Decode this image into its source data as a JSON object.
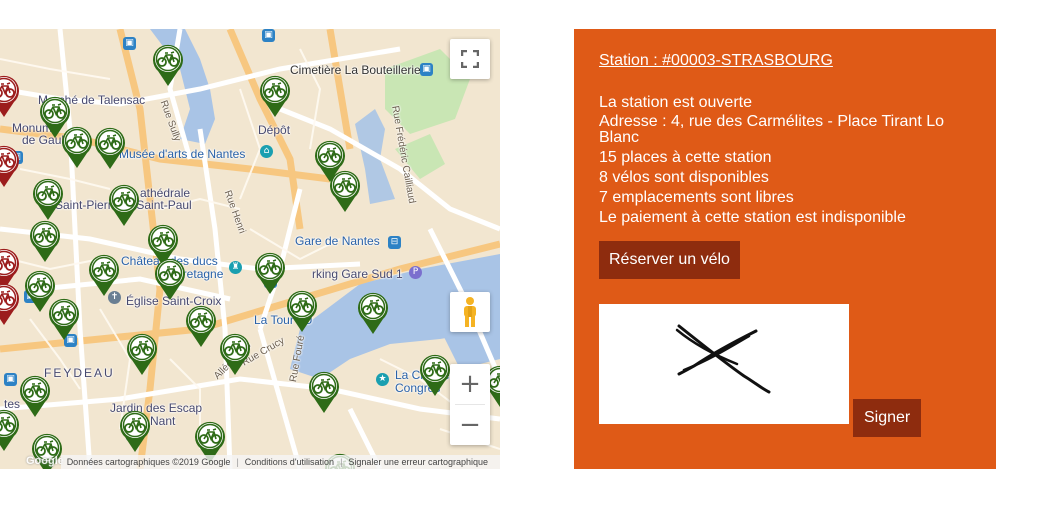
{
  "map": {
    "labels": {
      "cimetiere": "Cimetière La Bouteillerie",
      "talensac": "Marché de Talensac",
      "monument": "Monume",
      "degaulle": "de Gaulle",
      "depot": "Dépôt",
      "musee": "Musée d'arts de Nantes",
      "cathedrale": "athédrale",
      "saintpierre": "Saint-Pierre-et-Saint-Paul",
      "chateau1": "Château des ducs",
      "chateau2": "de Bretagne",
      "gare": "Gare de Nantes",
      "parking": "rking Gare Sud 1",
      "eglise": "Église Saint-Croix",
      "tourlu": "La Tour LU",
      "feydeau": "FEYDEAU",
      "citecongres1": "La Cité des",
      "citecongres2": "Congrès",
      "jardin1": "Jardin des Escap",
      "jardin2": "e Nant",
      "rue_sully": "Rue Sully",
      "rue_henri": "Rue Henri",
      "rue_cailliaud": "Rue Frédéric Cailliaud",
      "allee_baco": "Allée Baco",
      "rue_crucy": "Rue Crucy",
      "rue_fouré": "Rue Fouré",
      "ts": "tes",
      "as": "as"
    },
    "attribution": {
      "data": "Données cartographiques ©2019 Google",
      "terms": "Conditions d'utilisation",
      "report": "Signaler une erreur cartographique"
    },
    "google_logo": "Google",
    "zoom_in": "+",
    "zoom_out": "−",
    "marker_icon": "bicycle-icon",
    "marker_colors": {
      "available": "#2e6b17",
      "empty": "#9c1d1d"
    }
  },
  "station": {
    "title": "Station : #00003-STRASBOURG",
    "status": "La station est ouverte",
    "address": "Adresse : 4, rue des Carmélites - Place Tirant Lo Blanc",
    "places": "15 places à cette station",
    "bikes": "8 vélos sont disponibles",
    "free_slots": "7 emplacements sont libres",
    "payment": "Le paiement à cette station est indisponible",
    "reserve_label": "Réserver un vélo",
    "sign_label": "Signer"
  },
  "colors": {
    "panel_bg": "#df5a17",
    "button_bg": "#8e2c0e"
  }
}
